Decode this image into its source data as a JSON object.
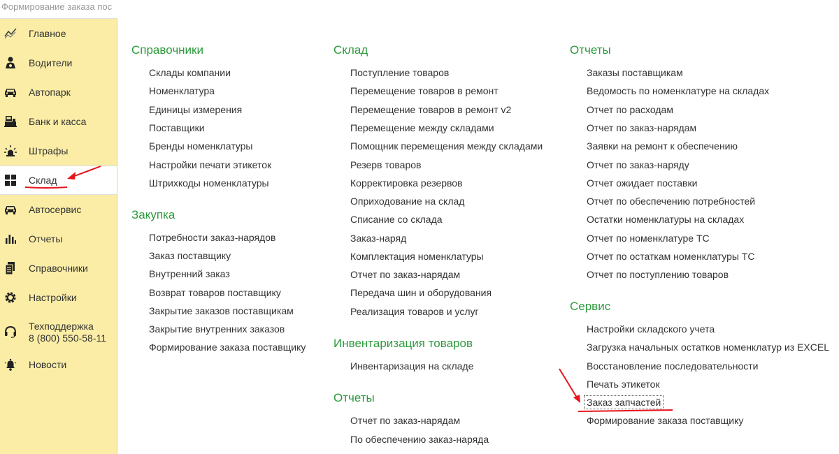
{
  "tab": {
    "title": "Формирование заказа пос"
  },
  "sidebar": {
    "items": [
      {
        "label": "Главное",
        "icon": "chart-trend-icon"
      },
      {
        "label": "Водители",
        "icon": "driver-icon"
      },
      {
        "label": "Автопарк",
        "icon": "car-icon"
      },
      {
        "label": "Банк и касса",
        "icon": "cash-register-icon"
      },
      {
        "label": "Штрафы",
        "icon": "siren-icon"
      },
      {
        "label": "Склад",
        "icon": "grid-icon",
        "active": true
      },
      {
        "label": "Автосервис",
        "icon": "car-icon"
      },
      {
        "label": "Отчеты",
        "icon": "bar-chart-icon"
      },
      {
        "label": "Справочники",
        "icon": "documents-icon"
      },
      {
        "label": "Настройки",
        "icon": "gear-icon"
      },
      {
        "label": "Техподдержка",
        "label2": "8 (800) 550-58-11",
        "icon": "headset-icon"
      },
      {
        "label": "Новости",
        "icon": "bell-icon"
      }
    ]
  },
  "columns": {
    "col1": {
      "sections": [
        {
          "title": "Справочники",
          "links": [
            "Склады компании",
            "Номенклатура",
            "Единицы измерения",
            "Поставщики",
            "Бренды номенклатуры",
            "Настройки печати этикеток",
            "Штрихкоды номенклатуры"
          ]
        },
        {
          "title": "Закупка",
          "links": [
            "Потребности заказ-нарядов",
            "Заказ поставщику",
            "Внутренний заказ",
            "Возврат товаров поставщику",
            "Закрытие заказов поставщикам",
            "Закрытие внутренних заказов",
            "Формирование заказа поставщику"
          ]
        }
      ]
    },
    "col2": {
      "sections": [
        {
          "title": "Склад",
          "links": [
            "Поступление товаров",
            "Перемещение товаров в ремонт",
            "Перемещение товаров в ремонт v2",
            "Перемещение между складами",
            "Помощник перемещения между складами",
            "Резерв товаров",
            "Корректировка резервов",
            "Оприходование на склад",
            "Списание со склада",
            "Заказ-наряд",
            "Комплектация номенклатуры",
            "Отчет по заказ-нарядам",
            "Передача шин и оборудования",
            "Реализация товаров и услуг"
          ]
        },
        {
          "title": "Инвентаризация товаров",
          "links": [
            "Инвентаризация на складе"
          ]
        },
        {
          "title": "Отчеты",
          "links": [
            "Отчет по заказ-нарядам",
            "По обеспечению заказ-наряда"
          ]
        }
      ]
    },
    "col3": {
      "sections": [
        {
          "title": "Отчеты",
          "links": [
            "Заказы поставщикам",
            "Ведомость по номенклатуре на складах",
            "Отчет по расходам",
            "Отчет по заказ-нарядам",
            "Заявки на ремонт к обеспечению",
            "Отчет по заказ-наряду",
            "Отчет ожидает поставки",
            "Отчет по обеспечению потребностей",
            "Остатки номенклатуры на складах",
            "Отчет по номенклатуре ТС",
            "Отчет по остаткам номенклатуры ТС",
            "Отчет по поступлению товаров"
          ]
        },
        {
          "title": "Сервис",
          "links": [
            "Настройки складского учета",
            "Загрузка начальных остатков номенклатур из EXCEL",
            "Восстановление последовательности",
            "Печать этикеток",
            "Заказ запчастей",
            "Формирование заказа поставщику"
          ],
          "focused_link": "Заказ запчастей"
        }
      ]
    }
  },
  "colors": {
    "sidebar_bg": "#fbeda6",
    "section_title": "#2c9a3c",
    "annotation": "#e8141b"
  }
}
